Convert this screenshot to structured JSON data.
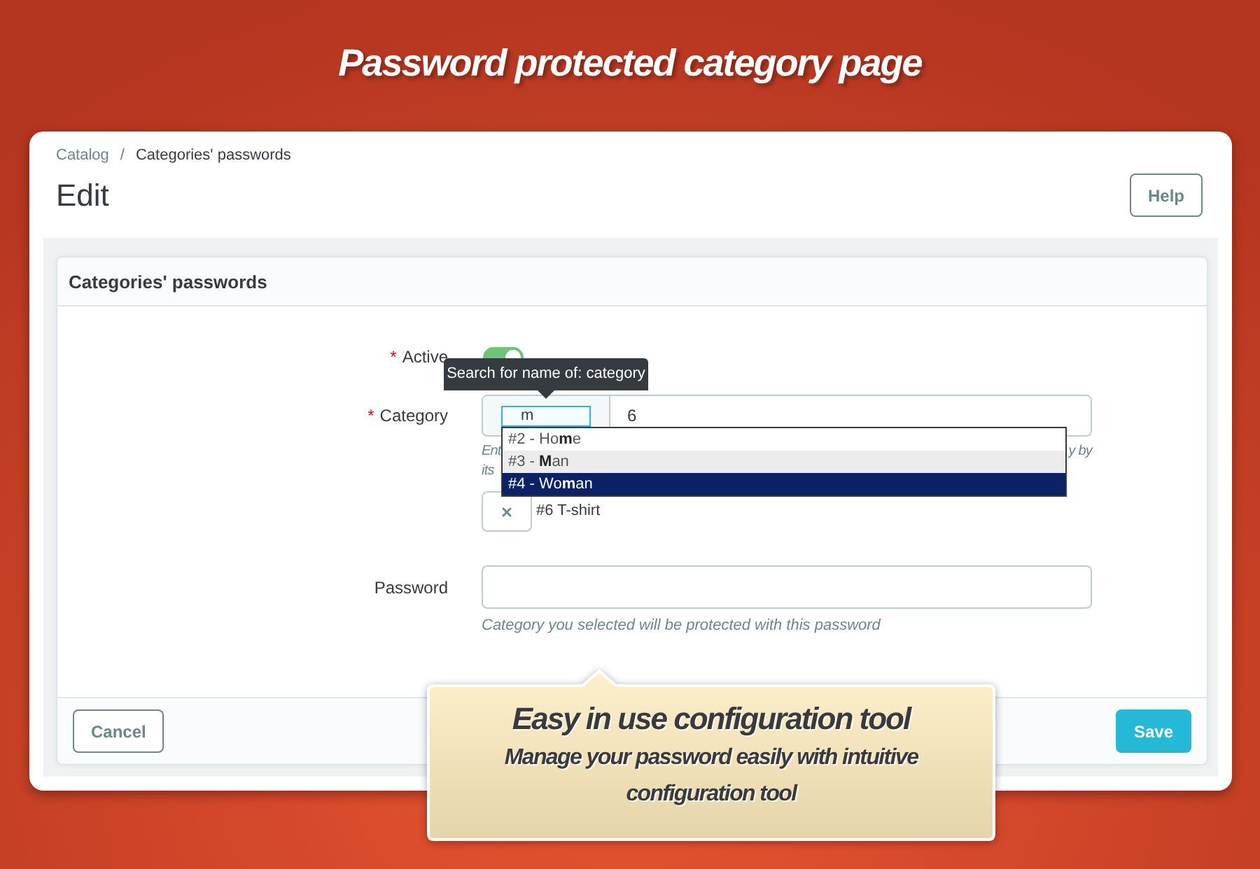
{
  "banner": {
    "title": "Password protected category page"
  },
  "breadcrumb": {
    "separator": "/",
    "items": [
      {
        "label": "Catalog",
        "current": false
      },
      {
        "label": "Categories' passwords",
        "current": true
      }
    ]
  },
  "page": {
    "title": "Edit",
    "help_button": "Help"
  },
  "panel": {
    "title": "Categories' passwords"
  },
  "form": {
    "active": {
      "label": "Active",
      "required_mark": "*",
      "on": true
    },
    "category": {
      "label": "Category",
      "required_mark": "*",
      "search_value": "m",
      "tooltip": "Search for name of: category",
      "value": "6",
      "hint_lines": [
        {
          "start": "Ent",
          "end": "y by"
        },
        {
          "start": "its"
        }
      ],
      "suggestions": [
        {
          "text": "#2 - Ho**m**e",
          "selected": false,
          "highlighted": false
        },
        {
          "text": "#3 - **M**an",
          "selected": false,
          "highlighted": true
        },
        {
          "text": "#4 - Wo**m**an",
          "selected": true,
          "highlighted": false
        }
      ],
      "selected_tags": [
        {
          "label": "#6 T-shirt"
        }
      ]
    },
    "password": {
      "label": "Password",
      "hint": "Category you selected will be protected with this password"
    }
  },
  "footer": {
    "cancel_button": "Cancel",
    "save_button": "Save"
  },
  "callout": {
    "title": "Easy in use configuration tool",
    "text": "Manage your password easily with intuitive configuration tool"
  }
}
